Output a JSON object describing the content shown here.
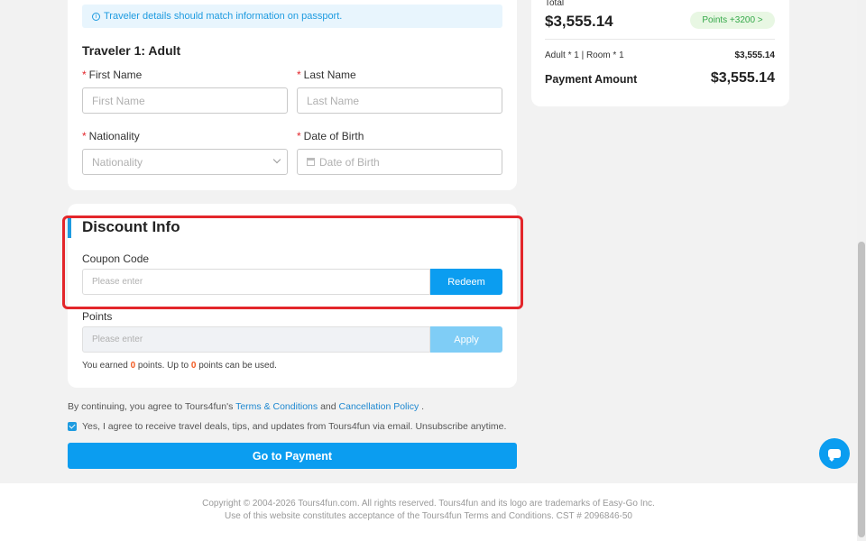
{
  "traveler": {
    "notice": "Traveler details should match information on passport.",
    "title": "Traveler 1: Adult",
    "first_name_label": "First Name",
    "first_name_placeholder": "First Name",
    "last_name_label": "Last Name",
    "last_name_placeholder": "Last Name",
    "nationality_label": "Nationality",
    "nationality_placeholder": "Nationality",
    "dob_label": "Date of Birth",
    "dob_placeholder": "Date of Birth",
    "required_mark": "*"
  },
  "discount": {
    "title": "Discount Info",
    "coupon_label": "Coupon Code",
    "coupon_placeholder": "Please enter",
    "redeem_label": "Redeem",
    "points_label": "Points",
    "points_placeholder": "Please enter",
    "apply_label": "Apply",
    "earned_prefix": "You earned",
    "earned_points": "0",
    "earned_middle": "points. Up to",
    "usable_points": "0",
    "earned_suffix": "points can be used."
  },
  "agreement": {
    "prefix": "By continuing, you agree to Tours4fun's",
    "terms_link": "Terms & Conditions",
    "and": "and",
    "cancellation_link": "Cancellation Policy",
    "suffix": ".",
    "optin_text": "Yes, I agree to receive travel deals, tips, and updates from Tours4fun via email. Unsubscribe anytime.",
    "optin_checked": true
  },
  "payment_button": "Go to Payment",
  "summary": {
    "total_label": "Total",
    "total_amount": "$3,555.14",
    "points_badge": "Points +3200 >",
    "line_label": "Adult * 1 | Room * 1",
    "line_amount": "$3,555.14",
    "payment_label": "Payment Amount",
    "payment_amount": "$3,555.14"
  },
  "footer": {
    "line1": "Copyright © 2004-2026 Tours4fun.com. All rights reserved. Tours4fun and its logo are trademarks of Easy-Go Inc.",
    "line2": "Use of this website constitutes acceptance of the Tours4fun Terms and Conditions. CST # 2096846-50"
  },
  "colors": {
    "accent": "#0b9df0",
    "highlight": "#e3262b",
    "points_orange": "#f15a22"
  },
  "icons": {
    "notice": "info-icon",
    "dropdown": "chevron-down-icon",
    "calendar": "calendar-icon",
    "chat": "chat-icon"
  }
}
